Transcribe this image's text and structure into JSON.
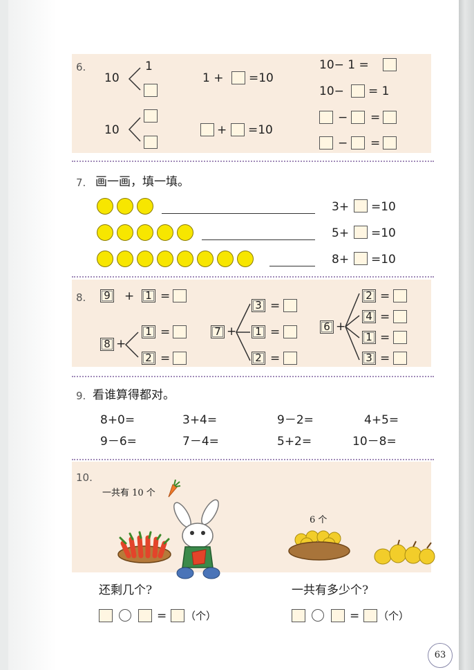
{
  "page_number": "63",
  "q6": {
    "label": "6.",
    "ten_a": "10",
    "one_top": "1",
    "ten_b": "10",
    "eq1_left": "1 +",
    "eq1_right": "=10",
    "eq2_plus": "+",
    "eq2_right": "=10",
    "r1": "10− 1 =",
    "r2_left": "10−",
    "r2_right": "= 1",
    "minus": "−",
    "eq": "="
  },
  "q7": {
    "label": "7.",
    "title": "画一画，填一填。",
    "rows": [
      {
        "dots": 3,
        "eq_left": "3+",
        "eq_right": "=10"
      },
      {
        "dots": 5,
        "eq_left": "5+",
        "eq_right": "=10"
      },
      {
        "dots": 8,
        "eq_left": "8+",
        "eq_right": "=10"
      }
    ]
  },
  "q8": {
    "label": "8.",
    "row1": {
      "a": "9",
      "op": "+",
      "b": "1",
      "eq": "="
    },
    "g1": {
      "base": "8",
      "op": "+",
      "addends": [
        "1",
        "2"
      ]
    },
    "g2": {
      "base": "7",
      "op": "+",
      "addends": [
        "3",
        "1",
        "2"
      ]
    },
    "g3": {
      "base": "6",
      "op": "+",
      "addends": [
        "2",
        "4",
        "1",
        "3"
      ]
    },
    "eq": "="
  },
  "q9": {
    "label": "9.",
    "title": "看谁算得都对。",
    "items": [
      "8+0=",
      "3+4=",
      "9－2=",
      "4+5=",
      "9－6=",
      "7－4=",
      "5+2=",
      "10－8="
    ]
  },
  "q10": {
    "label": "10.",
    "caption_left": "一共有 10 个",
    "caption_right": "6 个",
    "question_left": "还剩几个?",
    "question_right": "一共有多少个?",
    "eq": "=",
    "unit": "（个）"
  }
}
